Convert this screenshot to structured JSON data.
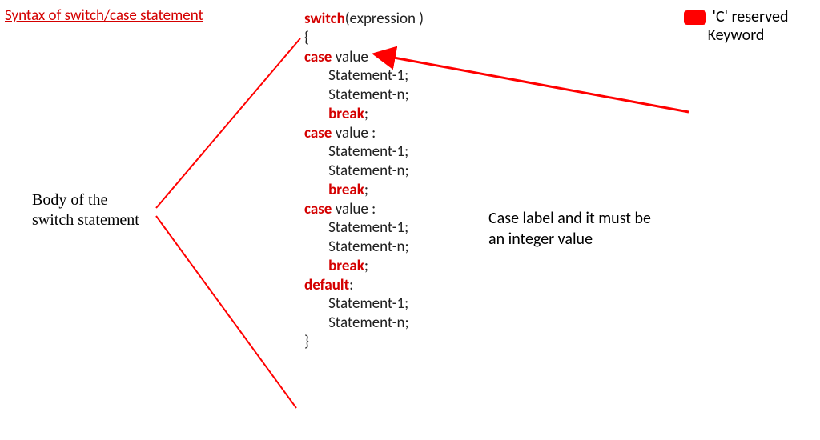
{
  "title": "Syntax of switch/case statement",
  "legend": {
    "line1": "'C' reserved",
    "line2": "Keyword"
  },
  "body_label": {
    "line1": "Body of the",
    "line2": "switch statement"
  },
  "case_label": {
    "line1": "Case label and it must be",
    "line2": "an integer value"
  },
  "kw": {
    "switch": "switch",
    "case": "case",
    "break": "break",
    "default": "default"
  },
  "txt": {
    "expr_open": "(expression )",
    "lbrace": "{",
    "rbrace": "}",
    "value_first": " value",
    "value_colon": " value :",
    "stmt1": "Statement-1;",
    "stmtn": "Statement-n;",
    "semicolon": ";",
    "colon": ":"
  },
  "colors": {
    "keyword": "#d40000",
    "arrow": "#ff0000"
  }
}
